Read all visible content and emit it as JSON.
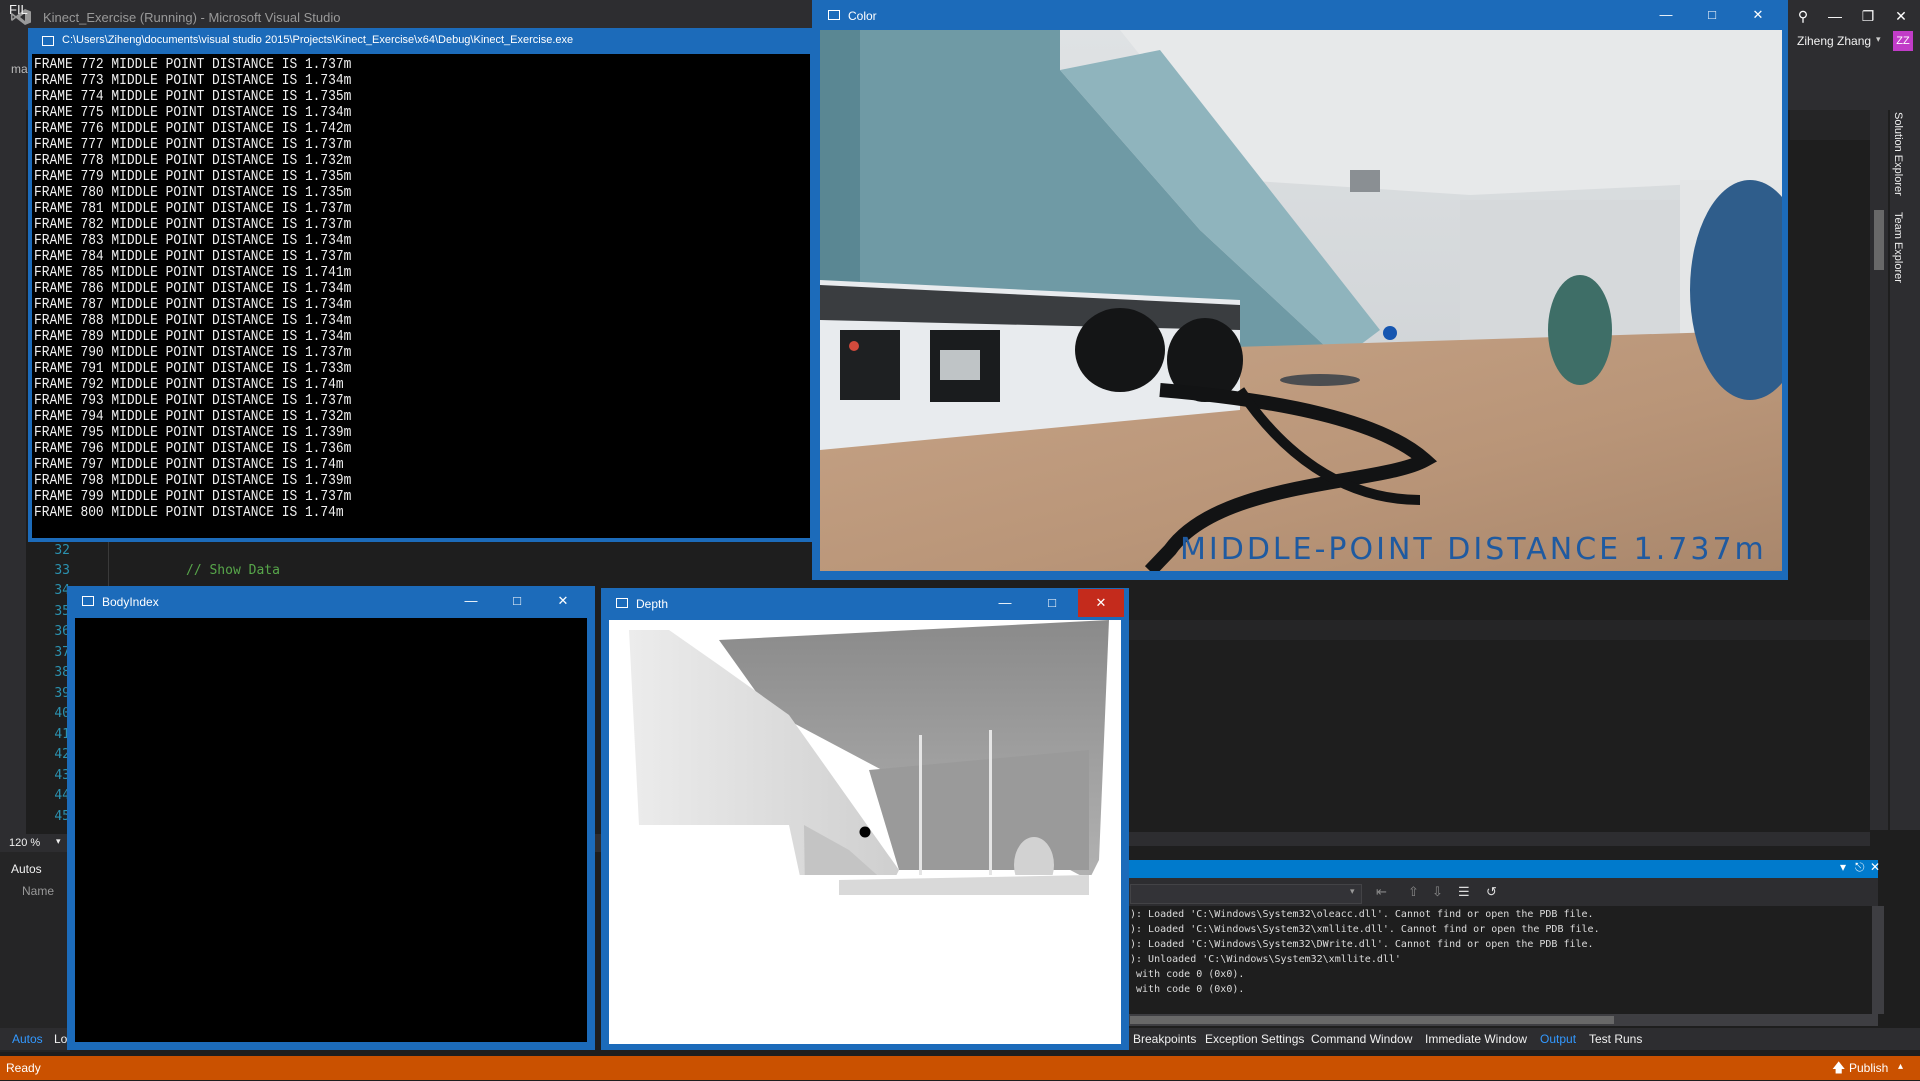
{
  "vs": {
    "title": "Kinect_Exercise (Running) - Microsoft Visual Studio",
    "menu_file": "FIL",
    "toolbar_fragment": "ma",
    "user_name": "Ziheng Zhang",
    "user_initials": "ZZ",
    "zoom": "120 %",
    "editor": {
      "line_numbers": [
        "32",
        "33",
        "34",
        "35",
        "36",
        "37",
        "38",
        "39",
        "40",
        "41",
        "42",
        "43",
        "44",
        "45"
      ],
      "comment": "// Show Data"
    },
    "autos": {
      "title": "Autos",
      "name_col": "Name",
      "tab_autos": "Autos",
      "tab_locals": "Lo"
    },
    "right_tabs": [
      "Solution Explorer",
      "Team Explorer"
    ],
    "output_lines": [
      "): Loaded 'C:\\Windows\\System32\\oleacc.dll'. Cannot find or open the PDB file.",
      "): Loaded 'C:\\Windows\\System32\\xmllite.dll'. Cannot find or open the PDB file.",
      "): Loaded 'C:\\Windows\\System32\\DWrite.dll'. Cannot find or open the PDB file.",
      "): Unloaded 'C:\\Windows\\System32\\xmllite.dll'",
      " with code 0 (0x0).",
      " with code 0 (0x0)."
    ],
    "bottom_tabs": [
      "Breakpoints",
      "Exception Settings",
      "Command Window",
      "Immediate Window",
      "Output",
      "Test Runs"
    ],
    "active_bottom_tab": "Output",
    "status": {
      "ready": "Ready",
      "publish": "Publish"
    }
  },
  "console": {
    "title": "C:\\Users\\Ziheng\\documents\\visual studio 2015\\Projects\\Kinect_Exercise\\x64\\Debug\\Kinect_Exercise.exe",
    "lines": [
      "FRAME 772 MIDDLE POINT DISTANCE IS 1.737m",
      "FRAME 773 MIDDLE POINT DISTANCE IS 1.734m",
      "FRAME 774 MIDDLE POINT DISTANCE IS 1.735m",
      "FRAME 775 MIDDLE POINT DISTANCE IS 1.734m",
      "FRAME 776 MIDDLE POINT DISTANCE IS 1.742m",
      "FRAME 777 MIDDLE POINT DISTANCE IS 1.737m",
      "FRAME 778 MIDDLE POINT DISTANCE IS 1.732m",
      "FRAME 779 MIDDLE POINT DISTANCE IS 1.735m",
      "FRAME 780 MIDDLE POINT DISTANCE IS 1.735m",
      "FRAME 781 MIDDLE POINT DISTANCE IS 1.737m",
      "FRAME 782 MIDDLE POINT DISTANCE IS 1.737m",
      "FRAME 783 MIDDLE POINT DISTANCE IS 1.734m",
      "FRAME 784 MIDDLE POINT DISTANCE IS 1.737m",
      "FRAME 785 MIDDLE POINT DISTANCE IS 1.741m",
      "FRAME 786 MIDDLE POINT DISTANCE IS 1.734m",
      "FRAME 787 MIDDLE POINT DISTANCE IS 1.734m",
      "FRAME 788 MIDDLE POINT DISTANCE IS 1.734m",
      "FRAME 789 MIDDLE POINT DISTANCE IS 1.734m",
      "FRAME 790 MIDDLE POINT DISTANCE IS 1.737m",
      "FRAME 791 MIDDLE POINT DISTANCE IS 1.733m",
      "FRAME 792 MIDDLE POINT DISTANCE IS 1.74m",
      "FRAME 793 MIDDLE POINT DISTANCE IS 1.737m",
      "FRAME 794 MIDDLE POINT DISTANCE IS 1.732m",
      "FRAME 795 MIDDLE POINT DISTANCE IS 1.739m",
      "FRAME 796 MIDDLE POINT DISTANCE IS 1.736m",
      "FRAME 797 MIDDLE POINT DISTANCE IS 1.74m",
      "FRAME 798 MIDDLE POINT DISTANCE IS 1.739m",
      "FRAME 799 MIDDLE POINT DISTANCE IS 1.737m",
      "FRAME 800 MIDDLE POINT DISTANCE IS 1.74m"
    ]
  },
  "color_window": {
    "title": "Color",
    "overlay": "MIDDLE-POINT DISTANCE 1.737m"
  },
  "bodyindex_window": {
    "title": "BodyIndex"
  },
  "depth_window": {
    "title": "Depth"
  },
  "icons": [
    "vs-logo-icon",
    "window-icon",
    "minimize-icon",
    "maximize-icon",
    "close-icon",
    "search-icon",
    "avatar",
    "publish-icon",
    "pin-icon"
  ],
  "colors": {
    "vs_dark": "#2d2d30",
    "vs_accent": "#007acc",
    "status_bar": "#ca5100",
    "window_frame": "#1c6bba",
    "close_red": "#c42b1c",
    "overlay_text": "#1f5aa0"
  }
}
